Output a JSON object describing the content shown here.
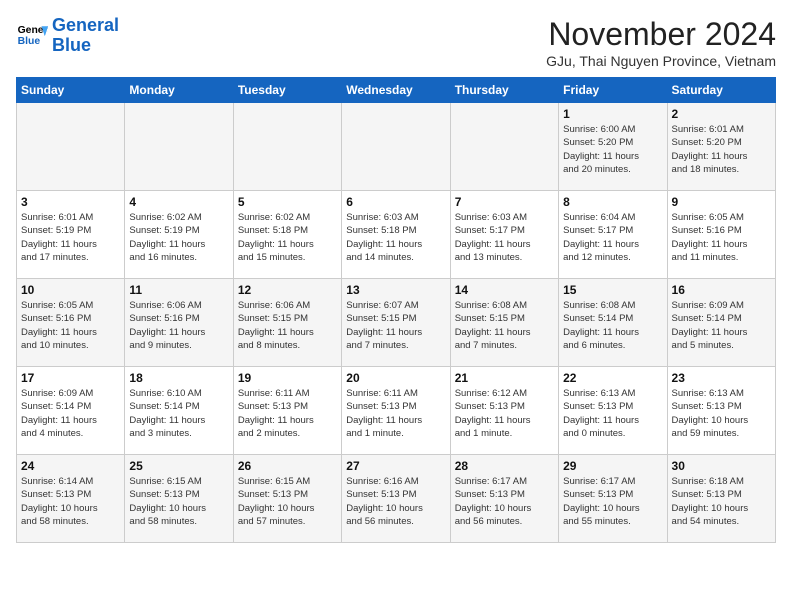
{
  "header": {
    "logo_line1": "General",
    "logo_line2": "Blue",
    "month_title": "November 2024",
    "subtitle": "GJu, Thai Nguyen Province, Vietnam"
  },
  "weekdays": [
    "Sunday",
    "Monday",
    "Tuesday",
    "Wednesday",
    "Thursday",
    "Friday",
    "Saturday"
  ],
  "weeks": [
    [
      {
        "day": "",
        "info": ""
      },
      {
        "day": "",
        "info": ""
      },
      {
        "day": "",
        "info": ""
      },
      {
        "day": "",
        "info": ""
      },
      {
        "day": "",
        "info": ""
      },
      {
        "day": "1",
        "info": "Sunrise: 6:00 AM\nSunset: 5:20 PM\nDaylight: 11 hours\nand 20 minutes."
      },
      {
        "day": "2",
        "info": "Sunrise: 6:01 AM\nSunset: 5:20 PM\nDaylight: 11 hours\nand 18 minutes."
      }
    ],
    [
      {
        "day": "3",
        "info": "Sunrise: 6:01 AM\nSunset: 5:19 PM\nDaylight: 11 hours\nand 17 minutes."
      },
      {
        "day": "4",
        "info": "Sunrise: 6:02 AM\nSunset: 5:19 PM\nDaylight: 11 hours\nand 16 minutes."
      },
      {
        "day": "5",
        "info": "Sunrise: 6:02 AM\nSunset: 5:18 PM\nDaylight: 11 hours\nand 15 minutes."
      },
      {
        "day": "6",
        "info": "Sunrise: 6:03 AM\nSunset: 5:18 PM\nDaylight: 11 hours\nand 14 minutes."
      },
      {
        "day": "7",
        "info": "Sunrise: 6:03 AM\nSunset: 5:17 PM\nDaylight: 11 hours\nand 13 minutes."
      },
      {
        "day": "8",
        "info": "Sunrise: 6:04 AM\nSunset: 5:17 PM\nDaylight: 11 hours\nand 12 minutes."
      },
      {
        "day": "9",
        "info": "Sunrise: 6:05 AM\nSunset: 5:16 PM\nDaylight: 11 hours\nand 11 minutes."
      }
    ],
    [
      {
        "day": "10",
        "info": "Sunrise: 6:05 AM\nSunset: 5:16 PM\nDaylight: 11 hours\nand 10 minutes."
      },
      {
        "day": "11",
        "info": "Sunrise: 6:06 AM\nSunset: 5:16 PM\nDaylight: 11 hours\nand 9 minutes."
      },
      {
        "day": "12",
        "info": "Sunrise: 6:06 AM\nSunset: 5:15 PM\nDaylight: 11 hours\nand 8 minutes."
      },
      {
        "day": "13",
        "info": "Sunrise: 6:07 AM\nSunset: 5:15 PM\nDaylight: 11 hours\nand 7 minutes."
      },
      {
        "day": "14",
        "info": "Sunrise: 6:08 AM\nSunset: 5:15 PM\nDaylight: 11 hours\nand 7 minutes."
      },
      {
        "day": "15",
        "info": "Sunrise: 6:08 AM\nSunset: 5:14 PM\nDaylight: 11 hours\nand 6 minutes."
      },
      {
        "day": "16",
        "info": "Sunrise: 6:09 AM\nSunset: 5:14 PM\nDaylight: 11 hours\nand 5 minutes."
      }
    ],
    [
      {
        "day": "17",
        "info": "Sunrise: 6:09 AM\nSunset: 5:14 PM\nDaylight: 11 hours\nand 4 minutes."
      },
      {
        "day": "18",
        "info": "Sunrise: 6:10 AM\nSunset: 5:14 PM\nDaylight: 11 hours\nand 3 minutes."
      },
      {
        "day": "19",
        "info": "Sunrise: 6:11 AM\nSunset: 5:13 PM\nDaylight: 11 hours\nand 2 minutes."
      },
      {
        "day": "20",
        "info": "Sunrise: 6:11 AM\nSunset: 5:13 PM\nDaylight: 11 hours\nand 1 minute."
      },
      {
        "day": "21",
        "info": "Sunrise: 6:12 AM\nSunset: 5:13 PM\nDaylight: 11 hours\nand 1 minute."
      },
      {
        "day": "22",
        "info": "Sunrise: 6:13 AM\nSunset: 5:13 PM\nDaylight: 11 hours\nand 0 minutes."
      },
      {
        "day": "23",
        "info": "Sunrise: 6:13 AM\nSunset: 5:13 PM\nDaylight: 10 hours\nand 59 minutes."
      }
    ],
    [
      {
        "day": "24",
        "info": "Sunrise: 6:14 AM\nSunset: 5:13 PM\nDaylight: 10 hours\nand 58 minutes."
      },
      {
        "day": "25",
        "info": "Sunrise: 6:15 AM\nSunset: 5:13 PM\nDaylight: 10 hours\nand 58 minutes."
      },
      {
        "day": "26",
        "info": "Sunrise: 6:15 AM\nSunset: 5:13 PM\nDaylight: 10 hours\nand 57 minutes."
      },
      {
        "day": "27",
        "info": "Sunrise: 6:16 AM\nSunset: 5:13 PM\nDaylight: 10 hours\nand 56 minutes."
      },
      {
        "day": "28",
        "info": "Sunrise: 6:17 AM\nSunset: 5:13 PM\nDaylight: 10 hours\nand 56 minutes."
      },
      {
        "day": "29",
        "info": "Sunrise: 6:17 AM\nSunset: 5:13 PM\nDaylight: 10 hours\nand 55 minutes."
      },
      {
        "day": "30",
        "info": "Sunrise: 6:18 AM\nSunset: 5:13 PM\nDaylight: 10 hours\nand 54 minutes."
      }
    ]
  ]
}
